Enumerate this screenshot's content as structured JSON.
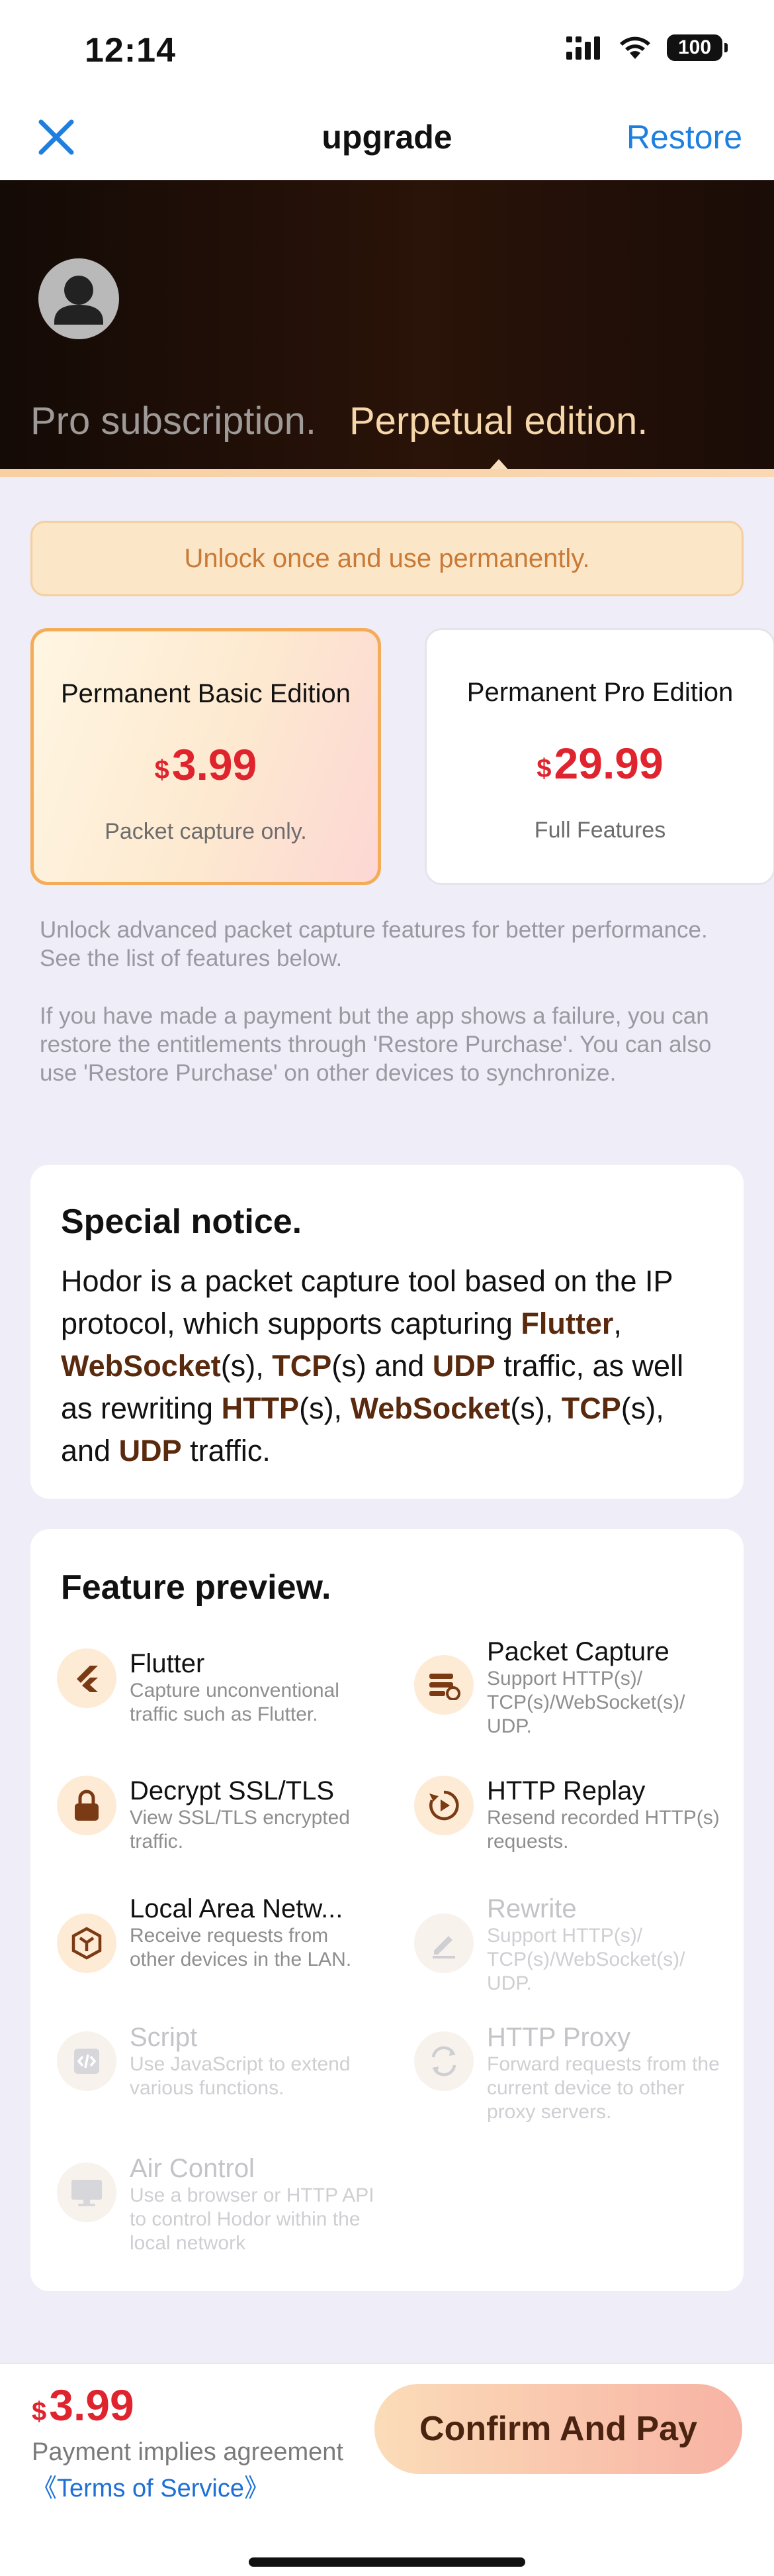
{
  "status_bar": {
    "time": "12:14",
    "battery": "100"
  },
  "nav": {
    "title": "upgrade",
    "restore": "Restore"
  },
  "tabs": [
    {
      "label": "Pro subscription."
    },
    {
      "label": "Perpetual edition."
    }
  ],
  "banner": "Unlock once and use permanently.",
  "plans": [
    {
      "name": "Permanent Basic Edition",
      "currency": "$",
      "price": "3.99",
      "desc": "Packet capture only."
    },
    {
      "name": "Permanent Pro Edition",
      "currency": "$",
      "price": "29.99",
      "desc": "Full Features"
    }
  ],
  "info": {
    "p1": "Unlock advanced packet capture features for better performance. See the list of features below.",
    "p2": "If you have made a payment but the app shows a failure, you can restore the entitlements through 'Restore Purchase'. You can also use 'Restore Purchase' on other devices to synchronize."
  },
  "notice": {
    "title": "Special notice.",
    "t1": "Hodor is a packet capture tool based on the IP protocol, which supports capturing ",
    "h1": "Flutter",
    "t2": ", ",
    "h2": "WebSocket",
    "t3": "(s), ",
    "h3": "TCP",
    "t4": "(s) and ",
    "h4": "UDP",
    "t5": " traffic, as well as rewriting ",
    "h5": "HTTP",
    "t6": "(s), ",
    "h6": "WebSocket",
    "t7": "(s), ",
    "h7": "TCP",
    "t8": "(s), and ",
    "h8": "UDP",
    "t9": " traffic."
  },
  "features": {
    "title": "Feature preview.",
    "items": [
      {
        "name": "Flutter",
        "desc": "Capture unconventional traffic such as Flutter.",
        "icon": "flutter-icon"
      },
      {
        "name": "Packet Capture",
        "desc": "Support HTTP(s)/ TCP(s)/WebSocket(s)/ UDP.",
        "icon": "packet-capture-icon"
      },
      {
        "name": "Decrypt SSL/TLS",
        "desc": "View SSL/TLS encrypted traffic.",
        "icon": "lock-icon"
      },
      {
        "name": "HTTP Replay",
        "desc": "Resend recorded HTTP(s) requests.",
        "icon": "replay-icon"
      },
      {
        "name": "Local Area Netw...",
        "desc": "Receive requests from other devices in the LAN.",
        "icon": "network-icon"
      },
      {
        "name": "Rewrite",
        "desc": "Support HTTP(s)/ TCP(s)/WebSocket(s)/ UDP.",
        "icon": "pencil-icon"
      },
      {
        "name": "Script",
        "desc": "Use JavaScript to extend various functions.",
        "icon": "code-icon"
      },
      {
        "name": "HTTP Proxy",
        "desc": "Forward requests from the current device to other proxy servers.",
        "icon": "proxy-icon"
      },
      {
        "name": "Air Control",
        "desc": "Use a browser or HTTP API to control Hodor within the local network",
        "icon": "monitor-icon"
      }
    ]
  },
  "bottom": {
    "currency": "$",
    "price": "3.99",
    "agree": "Payment implies agreement",
    "terms": "《Terms of Service》",
    "confirm": "Confirm And Pay"
  },
  "colors": {
    "accent_price": "#e0242e",
    "link": "#1e7fe0",
    "highlight": "#5a2a0e",
    "hero_active": "#f6d7a9"
  }
}
